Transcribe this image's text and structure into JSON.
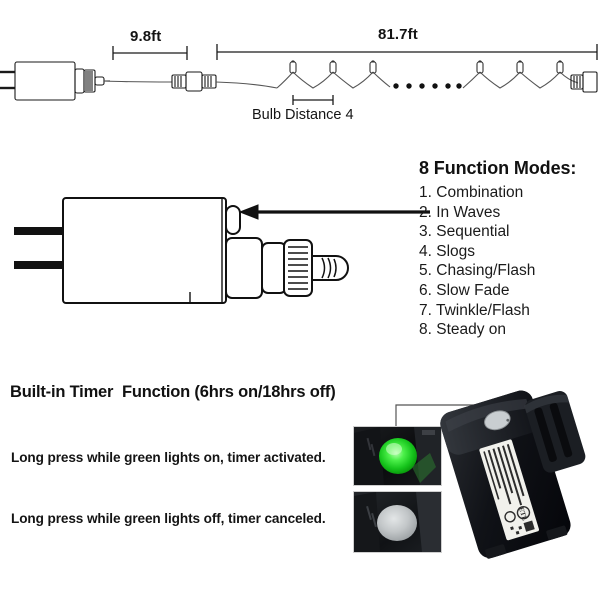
{
  "page": {
    "background": "#ffffff",
    "ink": "#111111"
  },
  "top_diagram": {
    "name": "string-light-layout-diagram",
    "lead_length": {
      "value": "9.8ft",
      "label": "9.8ft"
    },
    "lit_length": {
      "value": "81.7ft",
      "label": "81.7ft"
    },
    "bulb_distance": {
      "label": "Bulb Distance 4",
      "value": "4"
    },
    "parts": {
      "power_adapter": "power-adapter",
      "connector": "inline-connector",
      "bulbs": "led-bulb",
      "end_cap": "end-cap",
      "ellipsis": "• • • • • •"
    }
  },
  "adapter_diagram": {
    "name": "adapter-button-callout",
    "callout": "arrow pointing to button",
    "parts": {
      "prongs": "plug-prongs",
      "body": "adapter-body",
      "button": "timer-button",
      "nut": "threaded-nut",
      "cable": "output-cable"
    }
  },
  "modes": {
    "title": "8 Function Modes:",
    "items": [
      {
        "num": "1.",
        "label": "Combination"
      },
      {
        "num": "2.",
        "label": "In Waves"
      },
      {
        "num": "3.",
        "label": "Sequential"
      },
      {
        "num": "4.",
        "label": "Slogs"
      },
      {
        "num": "5.",
        "label": "Chasing/Flash"
      },
      {
        "num": "6.",
        "label": "Slow Fade"
      },
      {
        "num": "7.",
        "label": "Twinkle/Flash"
      },
      {
        "num": "8.",
        "label": "Steady on"
      }
    ]
  },
  "timer": {
    "title": "Built-in Timer  Function (6hrs on/18hrs off)",
    "line_on": "Long press while green lights on, timer activated.",
    "line_off": "Long press while green lights off, timer canceled.",
    "photos": {
      "green_button": "photo-button-green-lit",
      "grey_button": "photo-button-unlit",
      "adapter": "photo-power-adapter"
    },
    "colors": {
      "green_led": "#1fd427",
      "grey_button": "#b9bcbd",
      "adapter_body": "#16181c",
      "label_paper": "#f2f2ee"
    }
  }
}
